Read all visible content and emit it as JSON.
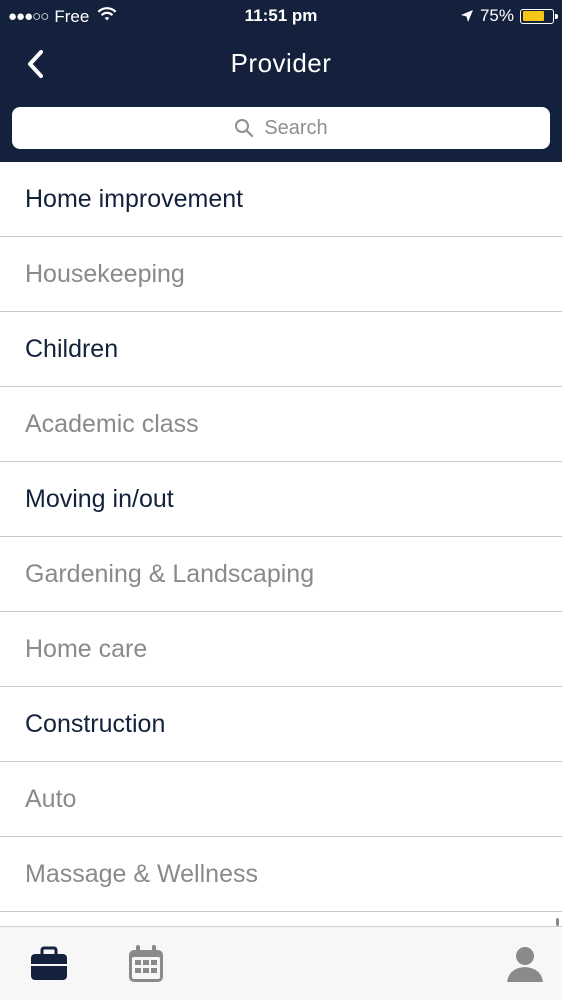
{
  "status_bar": {
    "signal": "●●●○○",
    "carrier": "Free",
    "time": "11:51 pm",
    "battery_percent_text": "75%",
    "battery_level": 0.75,
    "battery_color": "#f5c518",
    "icons": [
      "wifi-icon",
      "location-arrow-icon",
      "battery-icon"
    ]
  },
  "nav": {
    "title": "Provider",
    "back_icon": "chevron-left-icon"
  },
  "search": {
    "placeholder": "Search",
    "icon": "search-icon"
  },
  "categories": [
    {
      "label": "Home improvement",
      "style": "dark"
    },
    {
      "label": "Housekeeping",
      "style": "light"
    },
    {
      "label": "Children",
      "style": "dark"
    },
    {
      "label": "Academic class",
      "style": "light"
    },
    {
      "label": "Moving in/out",
      "style": "dark"
    },
    {
      "label": "Gardening & Landscaping",
      "style": "light"
    },
    {
      "label": "Home care",
      "style": "light"
    },
    {
      "label": "Construction",
      "style": "dark"
    },
    {
      "label": "Auto",
      "style": "light"
    },
    {
      "label": "Massage & Wellness",
      "style": "light"
    }
  ],
  "tab_bar": {
    "tabs": [
      "briefcase-icon",
      "calendar-icon",
      "profile-icon"
    ],
    "active": "briefcase-icon"
  },
  "colors": {
    "header_bg": "#14213d",
    "active_text": "#14213d",
    "inactive_text": "#8a8a8a",
    "divider": "#c8c8cc"
  }
}
